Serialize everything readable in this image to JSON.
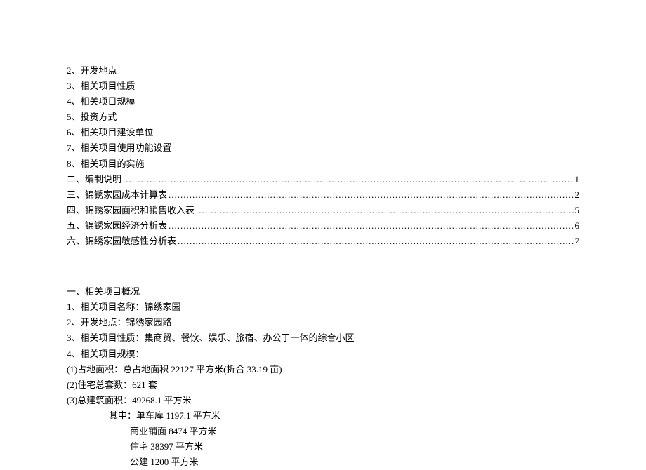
{
  "outline_items": [
    "2、开发地点",
    "3、相关项目性质",
    "4、相关项目规模",
    "5、投资方式",
    "6、相关项目建设单位",
    "7、相关项目使用功能设置",
    "8、相关项目的实施"
  ],
  "toc": [
    {
      "title": "二、编制说明",
      "page": "1"
    },
    {
      "title": "三、锦锈家园成本计算表",
      "page": "2"
    },
    {
      "title": "四、锦锈家园面积和销售收入表",
      "page": "5"
    },
    {
      "title": "五、锦锈家园经济分析表",
      "page": "6"
    },
    {
      "title": "六、锦绣家园敏感性分析表",
      "page": "7"
    }
  ],
  "section_heading": "一、相关项目概况",
  "details": {
    "name": "1、相关项目名称：锦绣家园",
    "location": "2、开发地点：锦绣家园路",
    "nature": "3、相关项目性质：集商贸、餐饮、娱乐、旅宿、办公于一体的综合小区",
    "scale_heading": "4、相关项目规模：",
    "scale_items": [
      "(1)占地面积：总占地面积 22127 平方米(折合 33.19 亩)",
      "(2)住宅总套数：621 套",
      "(3)总建筑面积：49268.1 平方米"
    ],
    "breakdown_lead": "其中：单车库 1197.1 平方米",
    "breakdown": [
      "商业铺面 8474 平方米",
      "住宅 38397 平方米",
      "公建 1200 平方米"
    ]
  },
  "dots": "........................................................................................................................................................................................................................"
}
